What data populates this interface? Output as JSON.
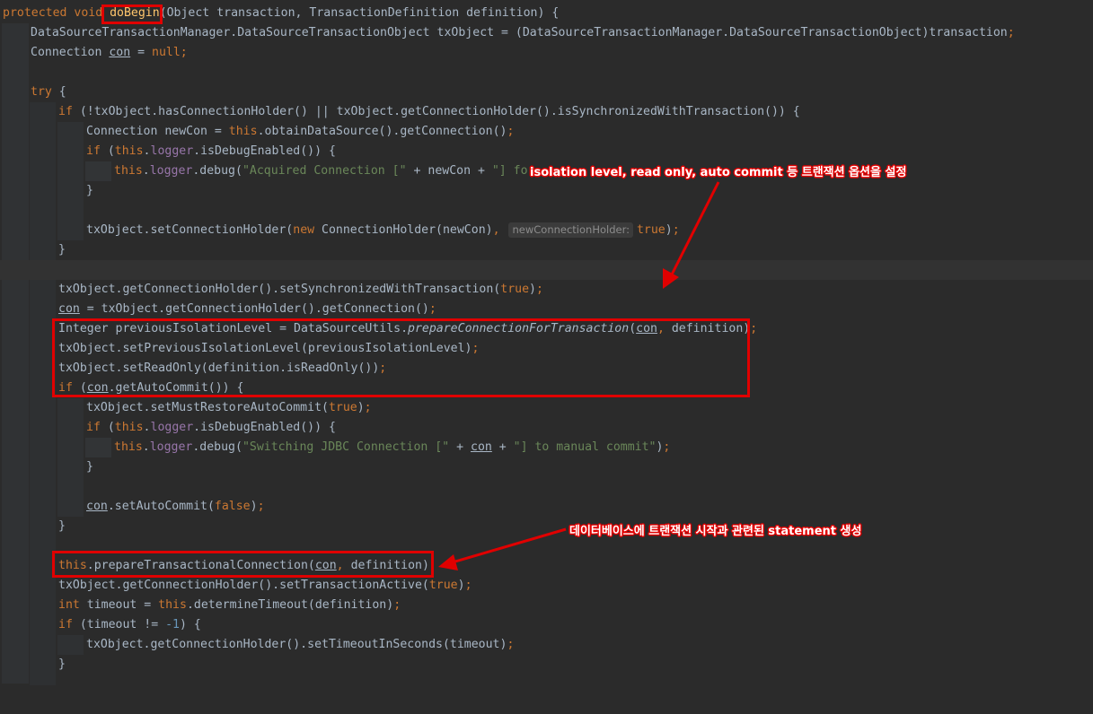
{
  "code": {
    "l1": {
      "kw1": "protected void ",
      "method": "doBegin",
      "rest": "(Object transaction, TransactionDefinition definition) {"
    },
    "l2": "DataSourceTransactionManager.DataSourceTransactionObject txObject = (DataSourceTransactionManager.DataSourceTransactionObject)transaction",
    "l2semi": ";",
    "l3": {
      "a": "Connection ",
      "con": "con",
      "b": " = ",
      "null": "null",
      "semi": ";"
    },
    "l5": {
      "try": "try",
      "rest": " {"
    },
    "l6": {
      "if": "if",
      "rest": " (!txObject.hasConnectionHolder() || txObject.getConnectionHolder().isSynchronizedWithTransaction()) {"
    },
    "l7": {
      "a": "Connection newCon = ",
      "this": "this",
      "b": ".obtainDataSource().getConnection()",
      "semi": ";"
    },
    "l8": {
      "if": "if",
      "a": " (",
      "this": "this",
      "dot": ".",
      "logger": "logger",
      "b": ".isDebugEnabled()) {"
    },
    "l9": {
      "this": "this",
      "dot": ".",
      "logger": "logger",
      "a": ".debug(",
      "str": "\"Acquired Connection [\"",
      "b": " + newCon + ",
      "str2": "\"] for"
    },
    "l10": "}",
    "l12": {
      "a": "txObject.setConnectionHolder(",
      "new": "new",
      "b": " ConnectionHolder(newCon)",
      "comma": ",",
      "hint": "newConnectionHolder:",
      "true": "true",
      "c": ")",
      "semi": ";"
    },
    "l13": "}",
    "l15": {
      "a": "txObject.getConnectionHolder().setSynchronizedWithTransaction(",
      "true": "true",
      "b": ")",
      "semi": ";"
    },
    "l16": {
      "con": "con",
      "a": " = txObject.getConnectionHolder().getConnection()",
      "semi": ";"
    },
    "l17": {
      "a": "Integer previousIsolationLevel = DataSourceUtils.",
      "m": "prepareConnectionForTransaction",
      "b": "(",
      "con": "con",
      "comma": ",",
      "c": " definition)",
      "semi": ";"
    },
    "l18": {
      "a": "txObject.setPreviousIsolationLevel(previousIsolationLevel)",
      "semi": ";"
    },
    "l19": {
      "a": "txObject.setReadOnly(definition.isReadOnly())",
      "semi": ";"
    },
    "l20": {
      "if": "if",
      "a": " (",
      "con": "con",
      "b": ".getAutoCommit()) {"
    },
    "l21": {
      "a": "txObject.setMustRestoreAutoCommit(",
      "true": "true",
      "b": ")",
      "semi": ";"
    },
    "l22": {
      "if": "if",
      "a": " (",
      "this": "this",
      "dot": ".",
      "logger": "logger",
      "b": ".isDebugEnabled()) {"
    },
    "l23": {
      "this": "this",
      "dot": ".",
      "logger": "logger",
      "a": ".debug(",
      "str": "\"Switching JDBC Connection [\"",
      "b": " + ",
      "con": "con",
      "c": " + ",
      "str2": "\"] to manual commit\"",
      "d": ")",
      "semi": ";"
    },
    "l24": "}",
    "l26": {
      "con": "con",
      "a": ".setAutoCommit(",
      "false": "false",
      "b": ")",
      "semi": ";"
    },
    "l27": "}",
    "l29": {
      "this": "this",
      "a": ".prepareTransactionalConnection(",
      "con": "con",
      "comma": ",",
      "b": " definition)",
      "semi": ";"
    },
    "l30": {
      "a": "txObject.getConnectionHolder().setTransactionActive(",
      "true": "true",
      "b": ")",
      "semi": ";"
    },
    "l31": {
      "int": "int",
      "a": " timeout = ",
      "this": "this",
      "b": ".determineTimeout(definition)",
      "semi": ";"
    },
    "l32": {
      "if": "if",
      "a": " (timeout != ",
      "num": "-1",
      "b": ") {"
    },
    "l33": {
      "a": "txObject.getConnectionHolder().setTimeoutInSeconds(timeout)",
      "semi": ";"
    },
    "l34": "}"
  },
  "annotations": {
    "top": "isolation level, read only, auto commit 등 트랜잭션 옵션을 설정",
    "bottom": "데이터베이스에 트랜잭션 시작과 관련된 statement 생성"
  },
  "colors": {
    "keyword": "#cc7832",
    "string": "#6a8759",
    "field": "#9876aa",
    "number": "#6897bb",
    "highlight": "#e00000",
    "background": "#2b2b2b"
  }
}
